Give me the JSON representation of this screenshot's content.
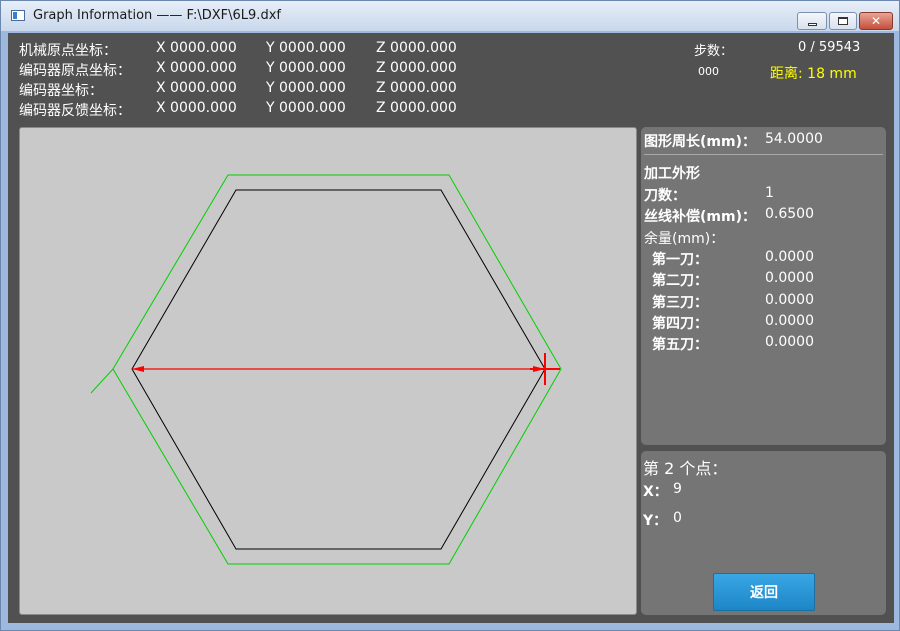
{
  "window": {
    "title": "Graph Information —— F:\\DXF\\6L9.dxf"
  },
  "coordinates": [
    {
      "label": "机械原点坐标：",
      "x": "X  0000.000",
      "y": "Y  0000.000",
      "z": "Z  0000.000"
    },
    {
      "label": "编码器原点坐标：",
      "x": "X  0000.000",
      "y": "Y  0000.000",
      "z": "Z  0000.000"
    },
    {
      "label": "编码器坐标：",
      "x": "X  0000.000",
      "y": "Y  0000.000",
      "z": "Z  0000.000"
    },
    {
      "label": "编码器反馈坐标：",
      "x": "X  0000.000",
      "y": "Y  0000.000",
      "z": "Z  0000.000"
    }
  ],
  "status": {
    "steps_label": "步数：",
    "steps_value": "0 / 59543",
    "code": "000",
    "distance": "距离:  18 mm",
    "distance_color": "#ffff00"
  },
  "canvas": {
    "background": "#c9c9c9",
    "shape_color": "#000000",
    "offset_color": "#00d000",
    "measure_color": "#ff0000"
  },
  "info": {
    "perimeter_label": "图形周长(mm)：",
    "perimeter_value": "54.0000",
    "process_label": "加工外形",
    "cuts_label": "刀数：",
    "cuts_value": "1",
    "comp_label": "丝线补偿(mm)：",
    "comp_value": "0.6500",
    "margin_label": "余量(mm)：",
    "passes": [
      {
        "label": "第一刀：",
        "value": "0.0000"
      },
      {
        "label": "第二刀：",
        "value": "0.0000"
      },
      {
        "label": "第三刀：",
        "value": "0.0000"
      },
      {
        "label": "第四刀：",
        "value": "0.0000"
      },
      {
        "label": "第五刀：",
        "value": "0.0000"
      }
    ]
  },
  "point": {
    "title": "第 2 个点：",
    "x_label": "X：",
    "x_value": "9",
    "y_label": "Y：",
    "y_value": "0"
  },
  "buttons": {
    "return_label": "返回"
  }
}
